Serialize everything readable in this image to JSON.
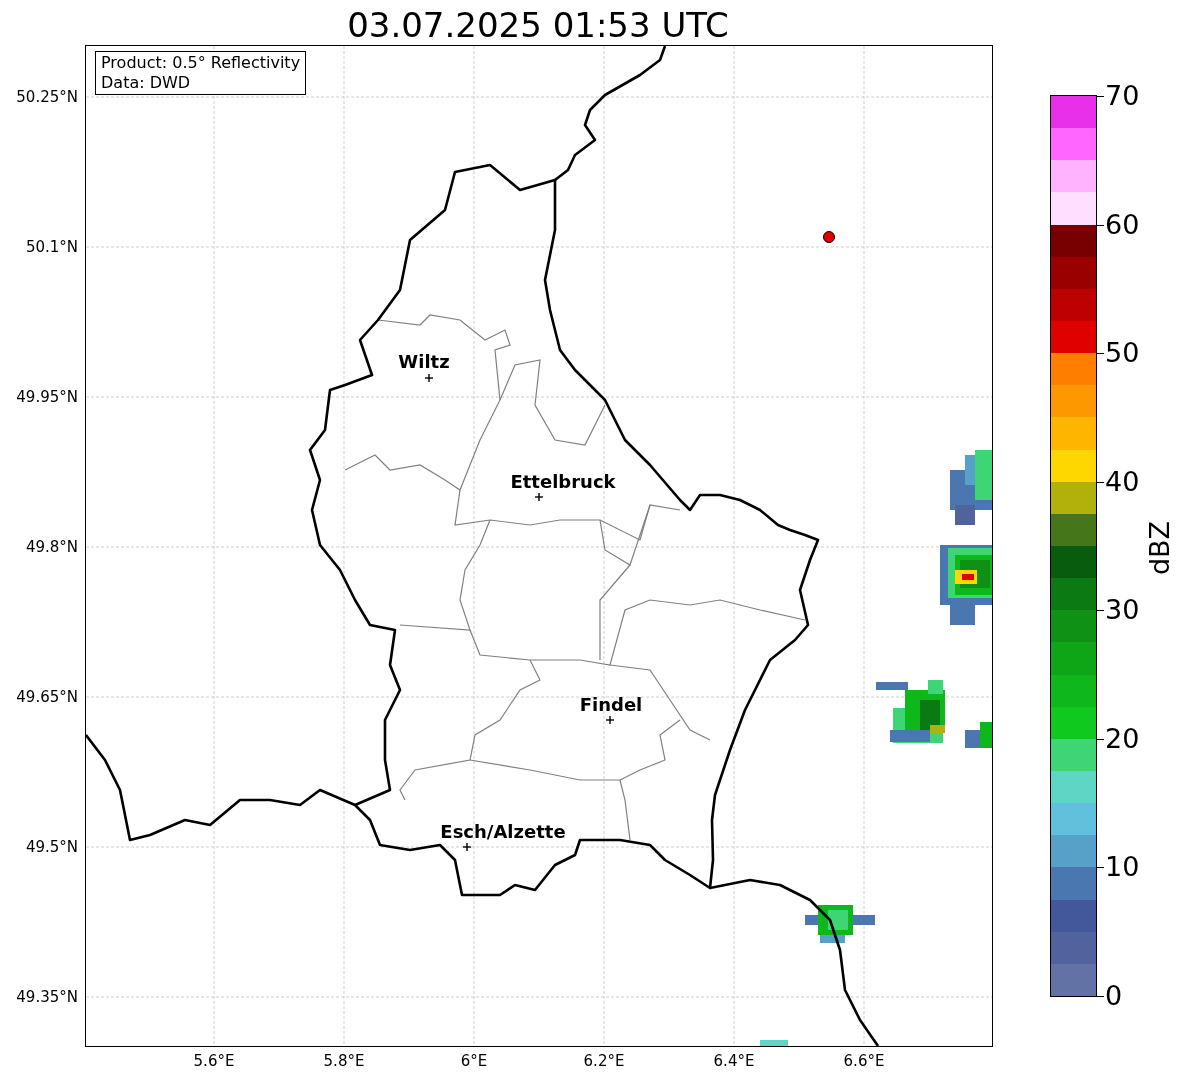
{
  "title": "03.07.2025 01:53 UTC",
  "info_box": [
    "Product: 0.5° Reflectivity",
    "Data: DWD"
  ],
  "y_ticks": [
    "50.25°N",
    "50.1°N",
    "49.95°N",
    "49.8°N",
    "49.65°N",
    "49.5°N",
    "49.35°N"
  ],
  "x_ticks": [
    "5.6°E",
    "5.8°E",
    "6°E",
    "6.2°E",
    "6.4°E",
    "6.6°E"
  ],
  "cities": [
    {
      "name": "Wiltz"
    },
    {
      "name": "Ettelbruck"
    },
    {
      "name": "Findel"
    },
    {
      "name": "Esch/Alzette"
    }
  ],
  "colorbar": {
    "label": "dBZ",
    "ticks": [
      "70",
      "60",
      "50",
      "40",
      "30",
      "20",
      "10",
      "0"
    ],
    "bins": [
      {
        "color": "#e830ea"
      },
      {
        "color": "#ff66ff"
      },
      {
        "color": "#ffb3ff"
      },
      {
        "color": "#ffdfff"
      },
      {
        "color": "#780000"
      },
      {
        "color": "#9a0000"
      },
      {
        "color": "#bd0000"
      },
      {
        "color": "#e00000"
      },
      {
        "color": "#fe7f00"
      },
      {
        "color": "#fe9800"
      },
      {
        "color": "#feb500"
      },
      {
        "color": "#fed700"
      },
      {
        "color": "#b1b10b"
      },
      {
        "color": "#46761a"
      },
      {
        "color": "#075c0e"
      },
      {
        "color": "#0b7a12"
      },
      {
        "color": "#0e9114"
      },
      {
        "color": "#0ea517"
      },
      {
        "color": "#0fb81a"
      },
      {
        "color": "#10c91f"
      },
      {
        "color": "#3ed575"
      },
      {
        "color": "#5ed6c6"
      },
      {
        "color": "#61c1dc"
      },
      {
        "color": "#57a0c8"
      },
      {
        "color": "#4a77b0"
      },
      {
        "color": "#42589b"
      },
      {
        "color": "#51639c"
      },
      {
        "color": "#6272a4"
      }
    ]
  }
}
